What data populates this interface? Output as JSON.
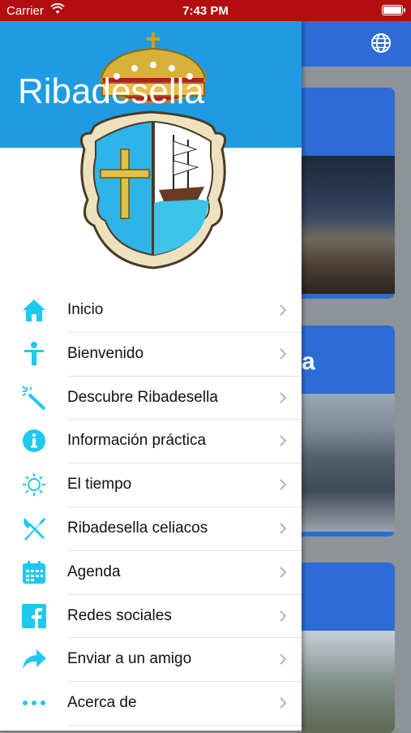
{
  "status_bar": {
    "carrier": "Carrier",
    "time": "7:43 PM"
  },
  "drawer": {
    "title": "Ribadesella"
  },
  "menu": [
    {
      "label": "Inicio",
      "icon": "home-icon"
    },
    {
      "label": "Bienvenido",
      "icon": "person-icon"
    },
    {
      "label": "Descubre Ribadesella",
      "icon": "magic-wand-icon"
    },
    {
      "label": "Información práctica",
      "icon": "info-icon"
    },
    {
      "label": "El tiempo",
      "icon": "sun-icon"
    },
    {
      "label": "Ribadesella celiacos",
      "icon": "fork-knife-icon"
    },
    {
      "label": "Agenda",
      "icon": "calendar-icon"
    },
    {
      "label": "Redes sociales",
      "icon": "facebook-icon"
    },
    {
      "label": "Enviar a un amigo",
      "icon": "share-arrow-icon"
    },
    {
      "label": "Acerca de",
      "icon": "more-dots-icon"
    }
  ],
  "background": {
    "card2_heading_fragment": "a"
  },
  "colors": {
    "status_bar": "#b40d10",
    "drawer_header": "#1e9be3",
    "icon": "#1ec8ef",
    "accent": "#2d6bd7"
  }
}
